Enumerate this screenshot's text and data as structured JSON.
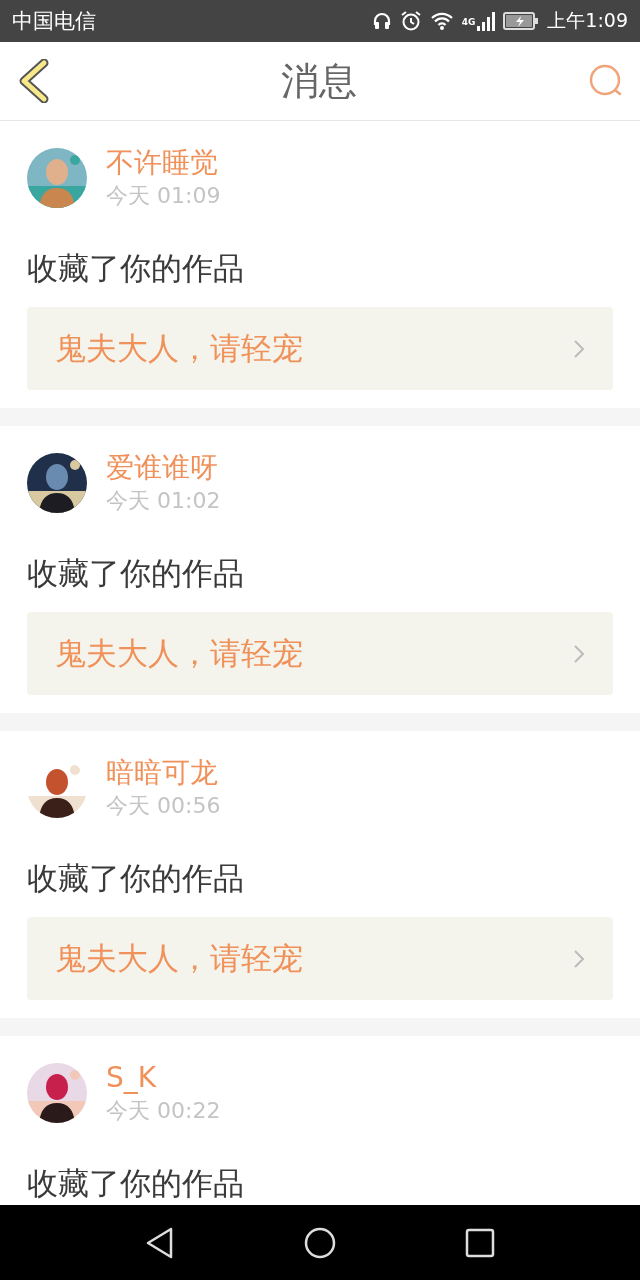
{
  "status_bar": {
    "carrier": "中国电信",
    "network": "4G",
    "time": "上午1:09"
  },
  "header": {
    "title": "消息"
  },
  "messages": [
    {
      "user": "不许睡觉",
      "time": "今天 01:09",
      "action": "收藏了你的作品",
      "work": "鬼夫大人，请轻宠"
    },
    {
      "user": "爱谁谁呀",
      "time": "今天 01:02",
      "action": "收藏了你的作品",
      "work": "鬼夫大人，请轻宠"
    },
    {
      "user": "暗暗可龙",
      "time": "今天 00:56",
      "action": "收藏了你的作品",
      "work": "鬼夫大人，请轻宠"
    },
    {
      "user": "S_K",
      "time": "今天 00:22",
      "action": "收藏了你的作品"
    }
  ]
}
